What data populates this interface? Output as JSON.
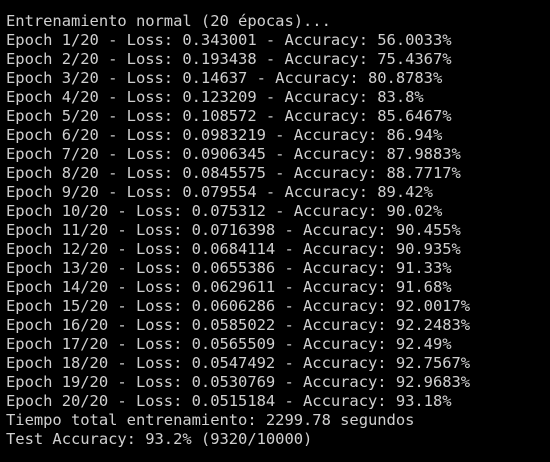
{
  "terminal": {
    "lines": [
      "Entrenamiento normal (20 épocas)...",
      "Epoch 1/20 - Loss: 0.343001 - Accuracy: 56.0033%",
      "Epoch 2/20 - Loss: 0.193438 - Accuracy: 75.4367%",
      "Epoch 3/20 - Loss: 0.14637 - Accuracy: 80.8783%",
      "Epoch 4/20 - Loss: 0.123209 - Accuracy: 83.8%",
      "Epoch 5/20 - Loss: 0.108572 - Accuracy: 85.6467%",
      "Epoch 6/20 - Loss: 0.0983219 - Accuracy: 86.94%",
      "Epoch 7/20 - Loss: 0.0906345 - Accuracy: 87.9883%",
      "Epoch 8/20 - Loss: 0.0845575 - Accuracy: 88.7717%",
      "Epoch 9/20 - Loss: 0.079554 - Accuracy: 89.42%",
      "Epoch 10/20 - Loss: 0.075312 - Accuracy: 90.02%",
      "Epoch 11/20 - Loss: 0.0716398 - Accuracy: 90.455%",
      "Epoch 12/20 - Loss: 0.0684114 - Accuracy: 90.935%",
      "Epoch 13/20 - Loss: 0.0655386 - Accuracy: 91.33%",
      "Epoch 14/20 - Loss: 0.0629611 - Accuracy: 91.68%",
      "Epoch 15/20 - Loss: 0.0606286 - Accuracy: 92.0017%",
      "Epoch 16/20 - Loss: 0.0585022 - Accuracy: 92.2483%",
      "Epoch 17/20 - Loss: 0.0565509 - Accuracy: 92.49%",
      "Epoch 18/20 - Loss: 0.0547492 - Accuracy: 92.7567%",
      "Epoch 19/20 - Loss: 0.0530769 - Accuracy: 92.9683%",
      "Epoch 20/20 - Loss: 0.0515184 - Accuracy: 93.18%",
      "Tiempo total entrenamiento: 2299.78 segundos",
      "Test Accuracy: 93.2% (9320/10000)"
    ]
  },
  "colors": {
    "background": "#000000",
    "text": "#d0d0d0"
  }
}
